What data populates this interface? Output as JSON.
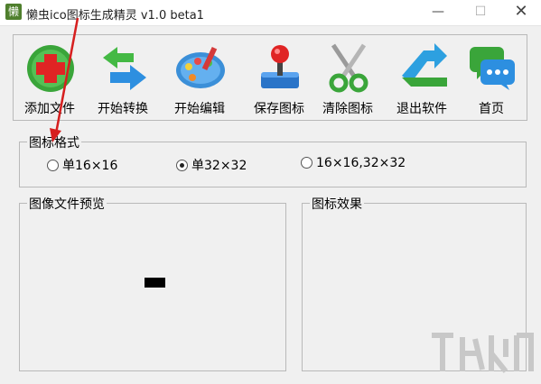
{
  "window": {
    "app_icon_char": "懒",
    "title": "懒虫ico图标生成精灵 v1.0 beta1",
    "min_glyph": "—",
    "max_glyph": "☐",
    "close_glyph": "✕"
  },
  "toolbar": {
    "add_file": "添加文件",
    "start_convert": "开始转换",
    "start_edit": "开始编辑",
    "save_icon": "保存图标",
    "clear_icon": "清除图标",
    "exit": "退出软件",
    "home": "首页"
  },
  "icon_format": {
    "title": "图标格式",
    "options": [
      "单16×16",
      "单32×32",
      "16×16,32×32"
    ],
    "selected": "单32×32"
  },
  "preview": {
    "title": "图像文件预览"
  },
  "effect": {
    "title": "图标效果"
  },
  "colors": {
    "accent_red": "#d61f1f",
    "panel_border": "#b9b9b9",
    "bg": "#f0f0f0"
  }
}
